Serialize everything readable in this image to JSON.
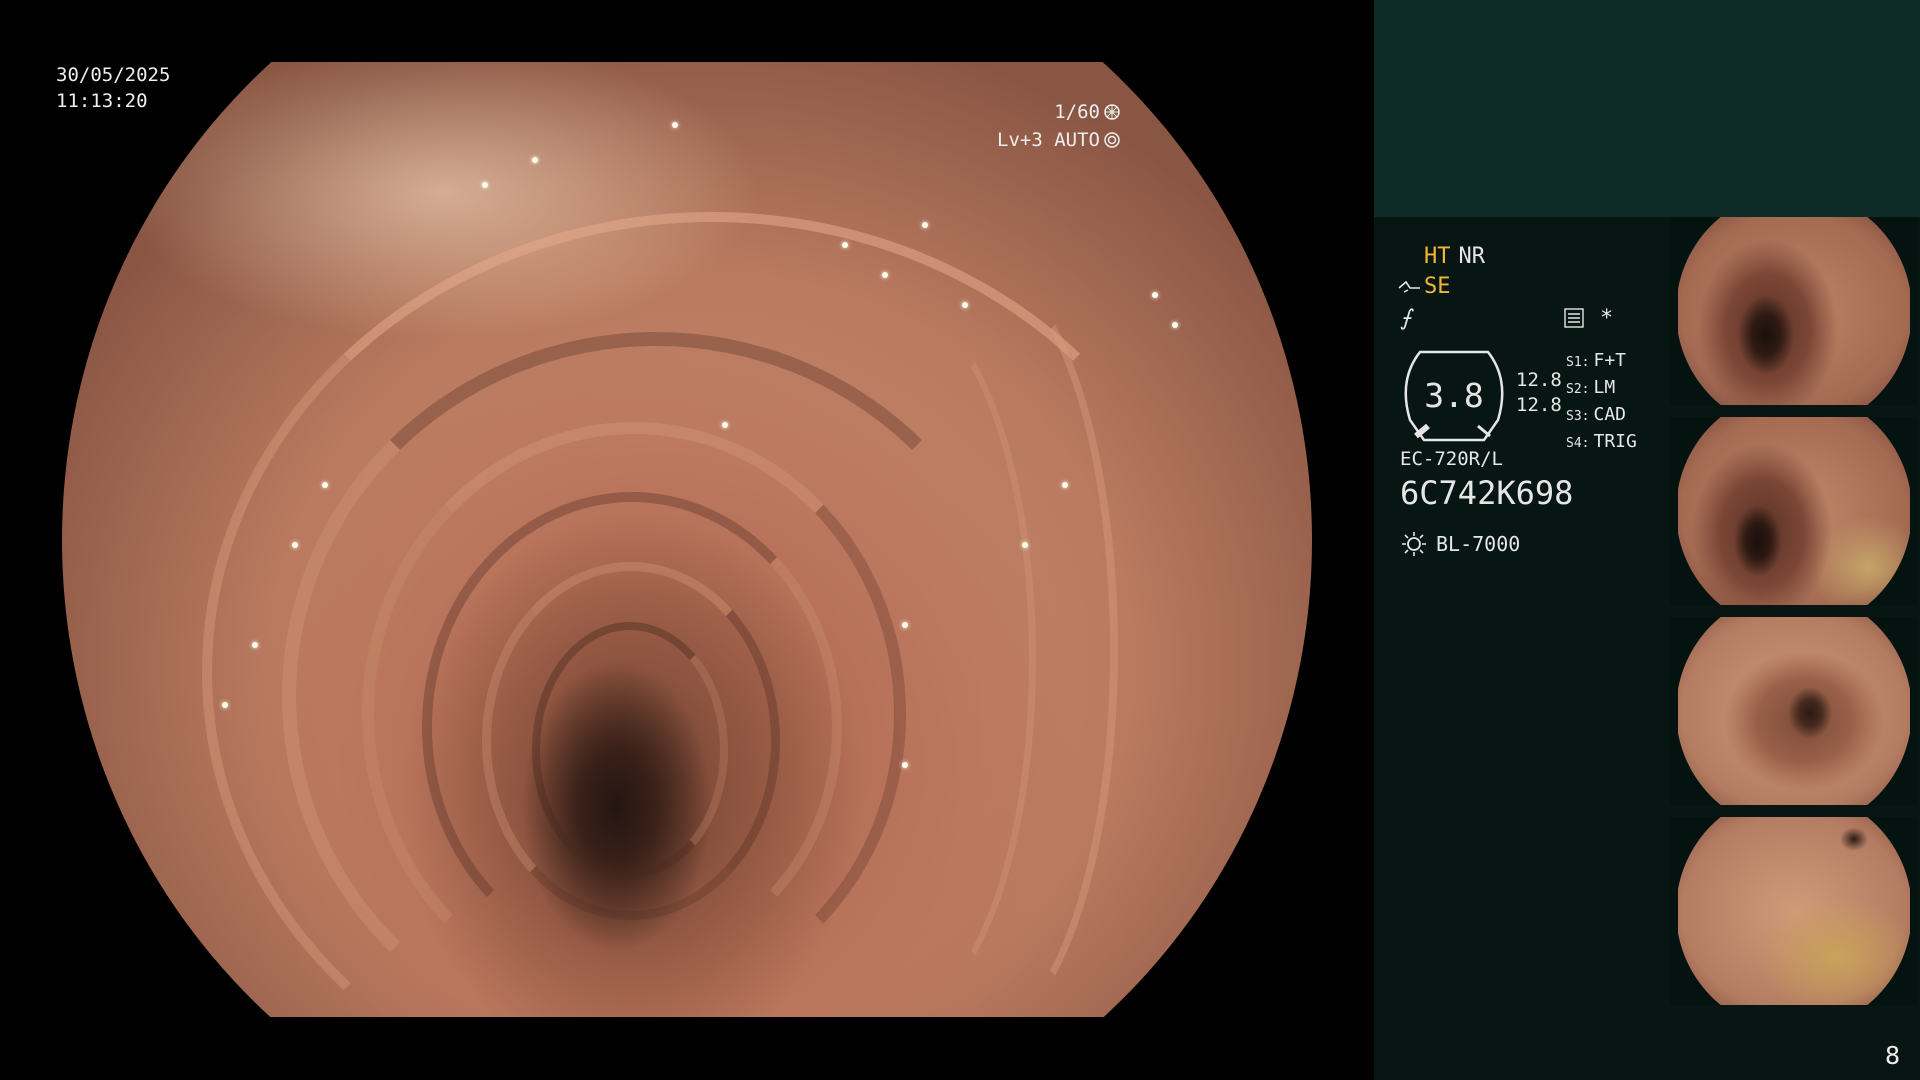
{
  "timestamp": {
    "date": "30/05/2025",
    "time": "11:13:20"
  },
  "exposure": {
    "shutter": "1/60",
    "level": "Lv+3 AUTO"
  },
  "settings": {
    "ht": "HT",
    "nr": "NR",
    "se": "SE",
    "star": "*",
    "gauge_value": "3.8",
    "gauge_sub_1": "12.8",
    "gauge_sub_2": "12.8",
    "slots": [
      {
        "key": "S1:",
        "value": "F+T"
      },
      {
        "key": "S2:",
        "value": "LM"
      },
      {
        "key": "S3:",
        "value": "CAD"
      },
      {
        "key": "S4:",
        "value": "TRIG"
      }
    ],
    "scope_model": "EC-720R/L",
    "serial": "6C742K698",
    "light_source": "BL-7000"
  },
  "icons": [
    "shutter-icon",
    "auto-iris-icon",
    "cable-icon",
    "f-curve-icon",
    "menu-icon",
    "light-source-icon"
  ],
  "colors": {
    "accent": "#f5b638",
    "panel_top": "#0f2b28",
    "panel": "#081613"
  },
  "page_number": "8"
}
